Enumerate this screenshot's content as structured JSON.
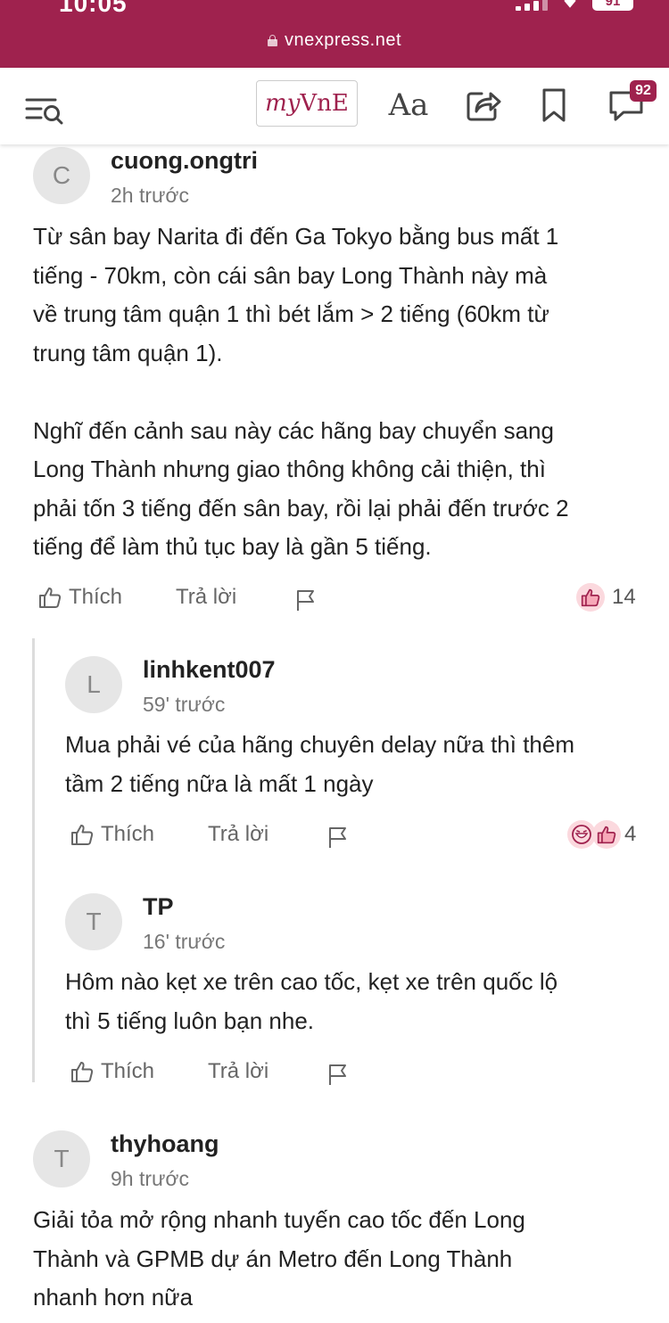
{
  "status_bar": {
    "time": "10:05",
    "battery": "91"
  },
  "browser": {
    "url": "vnexpress.net"
  },
  "header": {
    "myvne_prefix": "my",
    "myvne_suffix": "VnE",
    "font_label": "Aa",
    "comment_count": "92"
  },
  "comments": [
    {
      "avatar": "C",
      "author": "cuong.ongtri",
      "time": "2h trước",
      "text": "Từ sân bay Narita đi đến Ga Tokyo bằng bus mất 1\ntiếng - 70km, còn cái sân bay Long Thành này mà\nvề trung tâm quận 1 thì bét lắm > 2 tiếng (60km từ\ntrung tâm quận 1).\n\nNghĩ đến cảnh sau này các hãng bay chuyển sang\nLong Thành nhưng giao thông không cải thiện, thì\nphải tốn 3 tiếng đến sân bay, rồi lại phải đến trước 2\ntiếng để làm thủ tục bay là gần 5 tiếng.",
      "like_label": "Thích",
      "reply_label": "Trả lời",
      "reaction_count": "14"
    },
    {
      "avatar": "L",
      "author": "linhkent007",
      "time": "59' trước",
      "text": "Mua phải vé của hãng chuyên delay nữa thì thêm\ntầm 2 tiếng nữa là mất 1 ngày",
      "like_label": "Thích",
      "reply_label": "Trả lời",
      "reaction_count": "4"
    },
    {
      "avatar": "T",
      "author": "TP",
      "time": "16' trước",
      "text": "Hôm nào kẹt xe trên cao tốc, kẹt xe trên quốc lộ\nthì 5 tiếng luôn bạn nhe.",
      "like_label": "Thích",
      "reply_label": "Trả lời"
    },
    {
      "avatar": "T",
      "author": "thyhoang",
      "time": "9h trước",
      "text": "Giải tỏa mở rộng nhanh tuyến cao tốc đến Long\nThành và GPMB dự án Metro đến Long Thành\nnhanh hơn nữa"
    }
  ],
  "colors": {
    "brand": "#9f224e",
    "reaction_bg": "#fbd9de"
  }
}
